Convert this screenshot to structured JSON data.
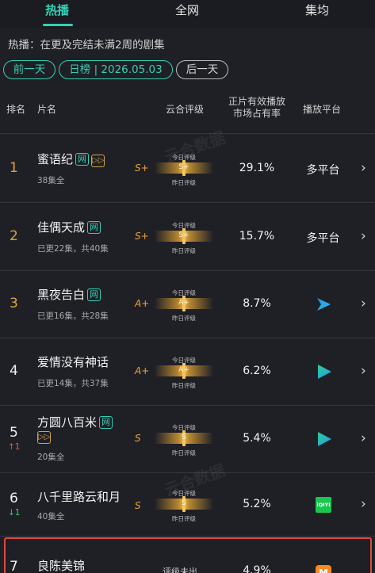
{
  "tabs": [
    {
      "label": "热播",
      "active": true
    },
    {
      "label": "全网",
      "active": false
    },
    {
      "label": "集均",
      "active": false
    }
  ],
  "description": "热播：在更及完结未满2周的剧集",
  "date_nav": {
    "prev": "前一天",
    "current": "日榜 | 2026.05.03",
    "next": "后一天"
  },
  "headers": {
    "rank": "排名",
    "name": "片名",
    "rating": "云合评级",
    "share_line1": "正片有效播放",
    "share_line2": "市场占有率",
    "platform": "播放平台"
  },
  "grade_labels": {
    "today": "今日评级",
    "yesterday": "昨日评级"
  },
  "rows": [
    {
      "rank": "1",
      "title": "蜜语纪",
      "episodes": "38集全",
      "grade": "S+",
      "grade_mid": "S+",
      "share": "29.1%",
      "platform": "多平台",
      "platform_icon": "none",
      "badge_wang": "网",
      "badge_play": "▷▷",
      "change": ""
    },
    {
      "rank": "2",
      "title": "佳偶天成",
      "episodes": "已更22集，共40集",
      "grade": "S+",
      "grade_mid": "S+",
      "share": "15.7%",
      "platform": "多平台",
      "platform_icon": "none",
      "badge_wang": "网",
      "badge_play": "",
      "change": ""
    },
    {
      "rank": "3",
      "title": "黑夜告白",
      "episodes": "已更16集，共28集",
      "grade": "A+",
      "grade_mid": "A+",
      "share": "8.7%",
      "platform": "",
      "platform_icon": "youku-icon",
      "badge_wang": "网",
      "badge_play": "",
      "change": ""
    },
    {
      "rank": "4",
      "title": "爱情没有神话",
      "episodes": "已更14集，共37集",
      "grade": "A+",
      "grade_mid": "A+",
      "share": "6.2%",
      "platform": "",
      "platform_icon": "tencent-video-icon",
      "badge_wang": "",
      "badge_play": "",
      "change": ""
    },
    {
      "rank": "5",
      "title": "方圆八百米",
      "episodes": "20集全",
      "grade": "S",
      "grade_mid": "S",
      "share": "5.4%",
      "platform": "",
      "platform_icon": "tencent-video-icon",
      "badge_wang": "网",
      "badge_play": "▷▷",
      "change": "↑1"
    },
    {
      "rank": "6",
      "title": "八千里路云和月",
      "episodes": "40集全",
      "grade": "S",
      "grade_mid": "S",
      "share": "5.2%",
      "platform": "",
      "platform_icon": "iqiyi-icon",
      "badge_wang": "",
      "badge_play": "",
      "change": "↓1"
    },
    {
      "rank": "7",
      "title": "良陈美锦",
      "episodes": "",
      "grade": "",
      "grade_mid": "",
      "grade_text": "评级未出",
      "share": "4.9%",
      "platform": "",
      "platform_icon": "mango-tv-icon",
      "badge_wang": "",
      "badge_play": "",
      "change": ""
    }
  ],
  "iqiyi_text": "iQIYI",
  "mango_text": "M",
  "watermark": "云合数据",
  "colors": {
    "accent": "#34d0b4",
    "rank_top": "#e0a43a",
    "grade": "#f0a33a",
    "up": "#e05a4e",
    "down": "#3ec76e",
    "highlight": "#e0483e"
  }
}
